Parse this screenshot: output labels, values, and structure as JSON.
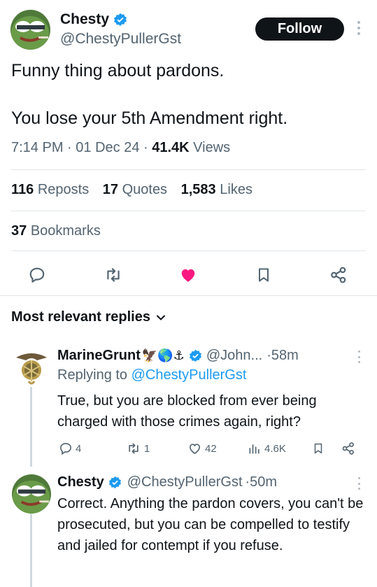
{
  "tweet": {
    "author": {
      "display_name": "Chesty",
      "handle": "@ChestyPullerGst",
      "avatar": "pepe-avatar",
      "verified": true
    },
    "follow_label": "Follow",
    "text_line1": "Funny thing about pardons.",
    "text_line2": "You lose your 5th Amendment right.",
    "time": "7:14 PM",
    "date": "01 Dec 24",
    "views_count": "41.4K",
    "views_label": "Views",
    "reposts_count": "116",
    "reposts_label": "Reposts",
    "quotes_count": "17",
    "quotes_label": "Quotes",
    "likes_count": "1,583",
    "likes_label": "Likes",
    "bookmarks_count": "37",
    "bookmarks_label": "Bookmarks",
    "liked": true
  },
  "actions": {
    "reply_icon": "reply-icon",
    "repost_icon": "repost-icon",
    "like_icon": "heart-icon",
    "bookmark_icon": "bookmark-icon",
    "share_icon": "share-icon"
  },
  "replies": {
    "header": "Most relevant replies",
    "items": [
      {
        "display_name": "MarineGrunt",
        "emoji": "🦅🌎⚓",
        "verified": true,
        "handle": "@John...",
        "time": "58m",
        "replying_prefix": "Replying to",
        "replying_to": "@ChestyPullerGst",
        "text": "True, but you are blocked from ever being charged with those crimes again, right?",
        "reply_count": "4",
        "repost_count": "1",
        "like_count": "42",
        "view_count": "4.6K"
      },
      {
        "display_name": "Chesty",
        "verified": true,
        "handle": "@ChestyPullerGst",
        "time": "50m",
        "text": "Correct. Anything the pardon covers, you can't be prosecuted, but you can be compelled to testify and jailed for contempt if you refuse."
      }
    ]
  },
  "colors": {
    "text": "#0f1419",
    "secondary": "#536471",
    "accent": "#1d9bf0",
    "like": "#f91880",
    "divider": "#e1e6ea"
  }
}
